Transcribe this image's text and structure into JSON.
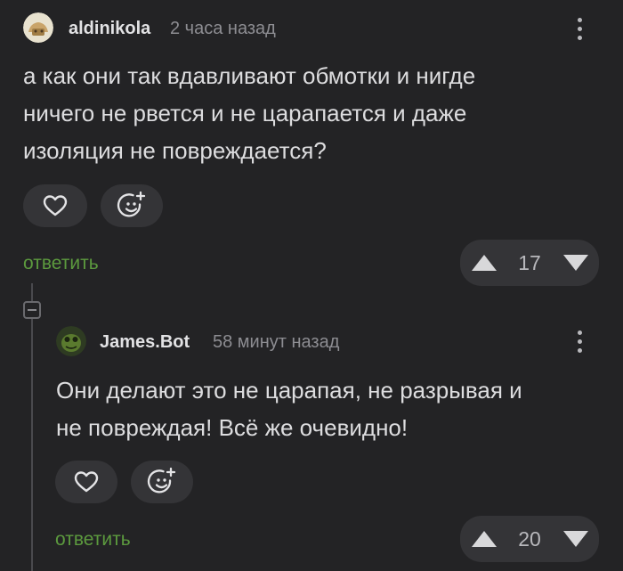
{
  "comment_1": {
    "username": "aldinikola",
    "timestamp": "2 часа назад",
    "text_lines": [
      "а как они так вдавливают обмотки и нигде",
      "ничего не рвется и не царапается и даже",
      "изоляция не повреждается?"
    ],
    "reply_label": "ответить",
    "votes": "17"
  },
  "comment_2": {
    "username": "James.Bot",
    "timestamp": "58 минут назад",
    "text_lines": [
      "Они делают это не царапая, не разрывая и",
      "не повреждая! Всё же очевидно!"
    ],
    "reply_label": "ответить",
    "votes": "20"
  },
  "icons": {
    "like": "heart-icon",
    "reaction": "add-emoji-icon",
    "upvote": "triangle-up-icon",
    "downvote": "triangle-down-icon",
    "menu": "kebab-menu-icon",
    "collapse": "collapse-thread-icon"
  },
  "colors": {
    "background": "#232325",
    "button": "#343437",
    "reply_link": "#5c9a3e"
  }
}
